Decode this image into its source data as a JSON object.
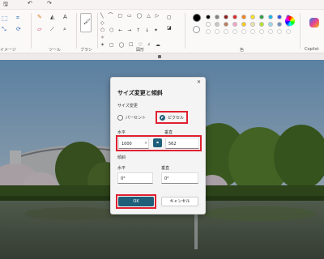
{
  "toolbar": {
    "groups": {
      "image": "イメージ",
      "tools": "ツール",
      "brushes": "ブラシ",
      "shapes": "図形",
      "colors": "色",
      "copilot": "Copilot"
    }
  },
  "colors": {
    "row1": [
      "#000000",
      "#7f7f7f",
      "#8b1a1a",
      "#e02a2a",
      "#f7821b",
      "#f9e21b",
      "#2ea043",
      "#19b4e8",
      "#2f54eb",
      "#8a2be2"
    ],
    "row2": [
      "#ffffff",
      "#c8c8c8",
      "#b97a57",
      "#f5a3c7",
      "#ffc90e",
      "#efe4b0",
      "#b5e61d",
      "#99d9ea",
      "#7092be",
      "#c8bfe7"
    ],
    "selected": "#000000",
    "secondary": "#ffffff"
  },
  "dialog": {
    "title": "サイズ変更と傾斜",
    "resize_section": "サイズ変更",
    "percent_option": "パーセント",
    "pixel_option": "ピクセル",
    "selected_unit": "pixel",
    "horizontal_label": "水平",
    "vertical_label": "垂直",
    "horizontal_value": "1000",
    "vertical_value": "562",
    "ratio_symbol": "×",
    "skew_section": "傾斜",
    "skew_horizontal_label": "水平",
    "skew_vertical_label": "垂直",
    "skew_horizontal_value": "0°",
    "skew_vertical_value": "0°",
    "ok": "OK",
    "cancel": "キャンセル",
    "close": "✕"
  }
}
